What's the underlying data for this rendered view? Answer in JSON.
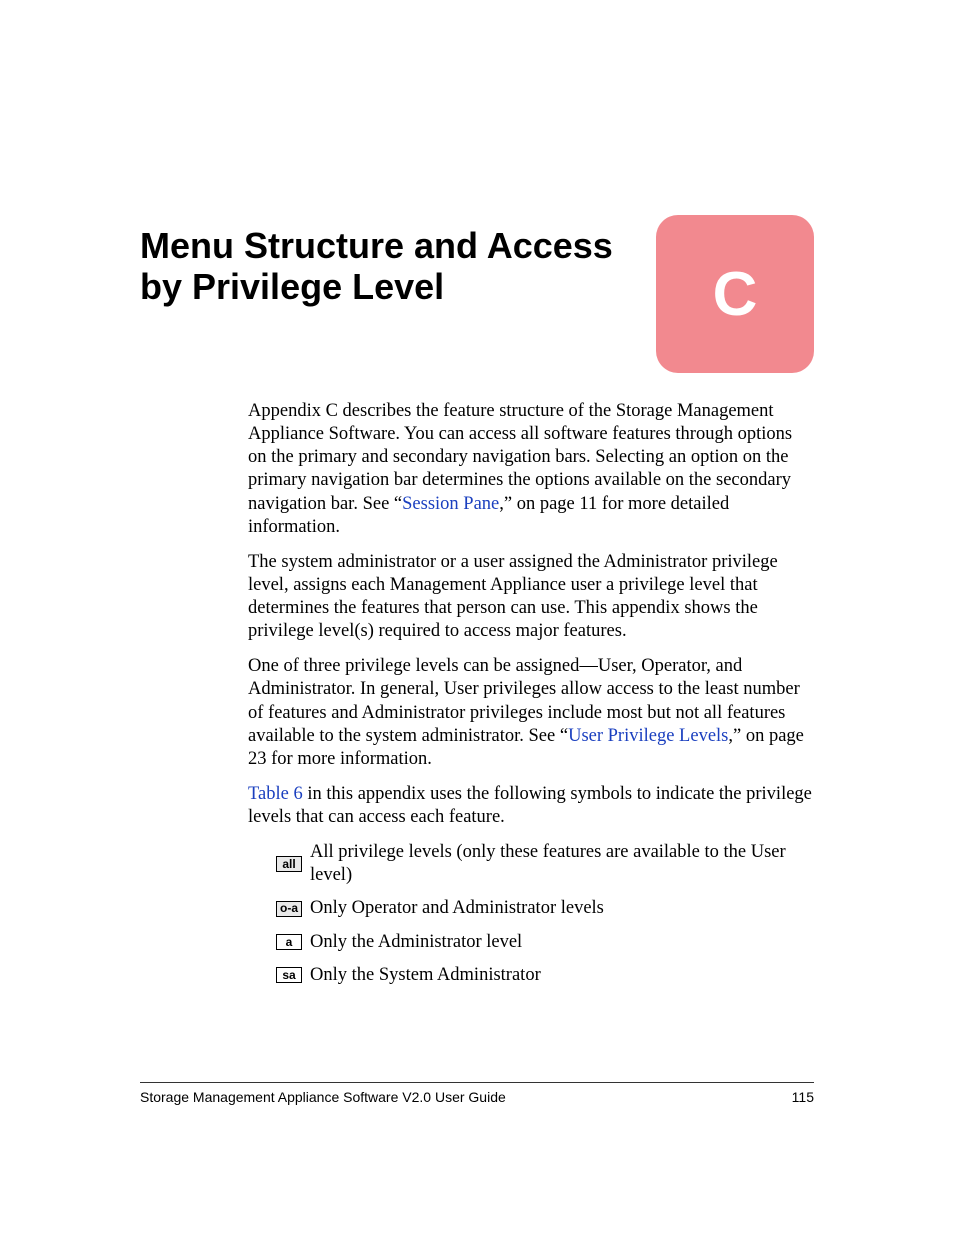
{
  "heading": "Menu Structure and Access by Privilege Level",
  "appendix_letter": "C",
  "paragraphs": {
    "p1_pre": "Appendix C describes the feature structure of the Storage Management Appliance Software. You can access all software features through options on the primary and secondary navigation bars. Selecting an option on the primary navigation bar determines the options available on the secondary navigation bar. See “",
    "p1_link": "Session Pane",
    "p1_post": ",” on page 11 for more detailed information.",
    "p2": "The system administrator or a user assigned the Administrator privilege level, assigns each Management Appliance user a privilege level that determines the features that person can use. This appendix shows the privilege level(s) required to access major features.",
    "p3_pre": "One of three privilege levels can be assigned—User, Operator, and Administrator. In general, User privileges allow access to the least number of features and Administrator privileges include most but not all features available to the system administrator. See “",
    "p3_link": "User Privilege Levels",
    "p3_post": ",” on page 23 for more information.",
    "p4_link": "Table 6",
    "p4_post": " in this appendix uses the following symbols to indicate the privilege levels that can access each feature."
  },
  "legend": [
    {
      "icon": "all",
      "text": "All privilege levels (only these features are available to the User level)"
    },
    {
      "icon": "o-a",
      "text": "Only Operator and Administrator levels"
    },
    {
      "icon": "a",
      "text": "Only the Administrator level"
    },
    {
      "icon": "sa",
      "text": "Only the System Administrator"
    }
  ],
  "footer": {
    "title": "Storage Management Appliance Software V2.0 User Guide",
    "page": "115"
  }
}
